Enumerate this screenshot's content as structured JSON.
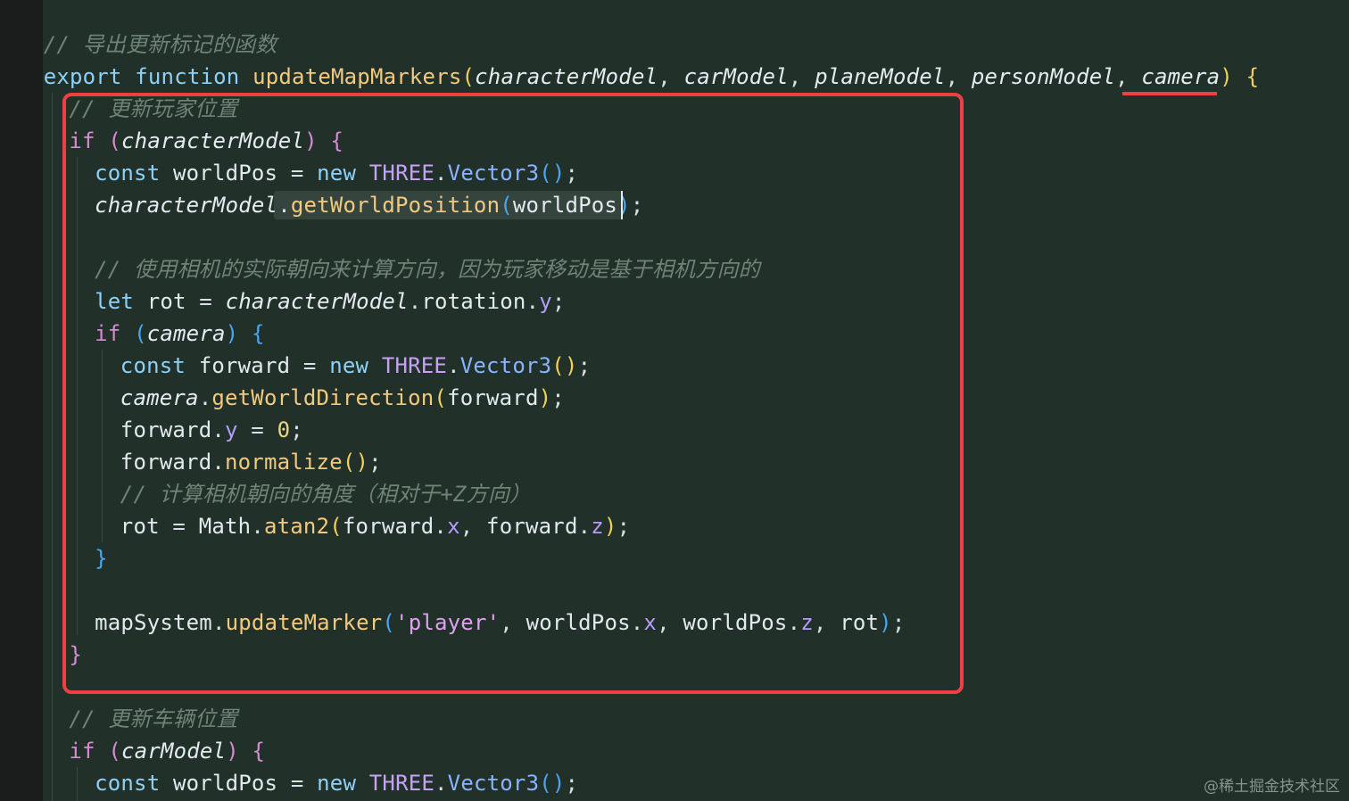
{
  "editor": {
    "lines": [
      {
        "name": "line-comment-export",
        "indent": 1,
        "tokens": [
          [
            "cmt",
            "// 导出更新标记的函数"
          ]
        ]
      },
      {
        "name": "line-export-function",
        "indent": 1,
        "tokens": [
          [
            "kw",
            "export"
          ],
          [
            "pun",
            " "
          ],
          [
            "kw",
            "function"
          ],
          [
            "pun",
            " "
          ],
          [
            "fn",
            "updateMapMarkers"
          ],
          [
            "b1",
            "("
          ],
          [
            "prm",
            "characterModel"
          ],
          [
            "pun",
            ", "
          ],
          [
            "prm",
            "carModel"
          ],
          [
            "pun",
            ", "
          ],
          [
            "prm",
            "planeModel"
          ],
          [
            "pun",
            ", "
          ],
          [
            "prm",
            "personModel"
          ],
          [
            "pun",
            ", "
          ],
          [
            "prm",
            "camera"
          ],
          [
            "b1",
            ")"
          ],
          [
            "pun",
            " "
          ],
          [
            "b1",
            "{"
          ]
        ]
      },
      {
        "name": "line-comment-player",
        "indent": 2,
        "tokens": [
          [
            "cmt",
            "// 更新玩家位置"
          ]
        ]
      },
      {
        "name": "line-if-character",
        "indent": 2,
        "tokens": [
          [
            "kwp",
            "if"
          ],
          [
            "pun",
            " "
          ],
          [
            "b2",
            "("
          ],
          [
            "prm",
            "characterModel"
          ],
          [
            "b2",
            ")"
          ],
          [
            "pun",
            " "
          ],
          [
            "b2",
            "{"
          ]
        ]
      },
      {
        "name": "line-const-worldpos",
        "indent": 3,
        "tokens": [
          [
            "kw",
            "const"
          ],
          [
            "pun",
            " "
          ],
          [
            "var",
            "worldPos"
          ],
          [
            "pun",
            " = "
          ],
          [
            "kw",
            "new"
          ],
          [
            "pun",
            " "
          ],
          [
            "cls",
            "THREE"
          ],
          [
            "pun",
            "."
          ],
          [
            "mth",
            "Vector3"
          ],
          [
            "b3",
            "()"
          ],
          [
            "pun",
            ";"
          ]
        ]
      },
      {
        "name": "line-get-world-position",
        "indent": 3,
        "tokens": [
          [
            "prm",
            "characterModel"
          ],
          [
            "pun",
            "."
          ],
          [
            "fn",
            "getWorldPosition"
          ],
          [
            "b3",
            "("
          ],
          [
            "var",
            "worldPos"
          ],
          [
            "b3",
            ")"
          ],
          [
            "pun",
            ";"
          ]
        ]
      },
      {
        "name": "line-blank-1",
        "indent": 0,
        "tokens": []
      },
      {
        "name": "line-comment-camera",
        "indent": 3,
        "tokens": [
          [
            "cmt",
            "// 使用相机的实际朝向来计算方向，因为玩家移动是基于相机方向的"
          ]
        ]
      },
      {
        "name": "line-let-rot",
        "indent": 3,
        "tokens": [
          [
            "kw",
            "let"
          ],
          [
            "pun",
            " "
          ],
          [
            "var",
            "rot"
          ],
          [
            "pun",
            " = "
          ],
          [
            "prm",
            "characterModel"
          ],
          [
            "pun",
            "."
          ],
          [
            "var",
            "rotation"
          ],
          [
            "pun",
            "."
          ],
          [
            "prp",
            "y"
          ],
          [
            "pun",
            ";"
          ]
        ]
      },
      {
        "name": "line-if-camera",
        "indent": 3,
        "tokens": [
          [
            "kwp",
            "if"
          ],
          [
            "pun",
            " "
          ],
          [
            "b3",
            "("
          ],
          [
            "prm",
            "camera"
          ],
          [
            "b3",
            ")"
          ],
          [
            "pun",
            " "
          ],
          [
            "b3",
            "{"
          ]
        ]
      },
      {
        "name": "line-const-forward",
        "indent": 4,
        "tokens": [
          [
            "kw",
            "const"
          ],
          [
            "pun",
            " "
          ],
          [
            "var",
            "forward"
          ],
          [
            "pun",
            " = "
          ],
          [
            "kw",
            "new"
          ],
          [
            "pun",
            " "
          ],
          [
            "cls",
            "THREE"
          ],
          [
            "pun",
            "."
          ],
          [
            "mth",
            "Vector3"
          ],
          [
            "b1",
            "()"
          ],
          [
            "pun",
            ";"
          ]
        ]
      },
      {
        "name": "line-get-world-direction",
        "indent": 4,
        "tokens": [
          [
            "prm",
            "camera"
          ],
          [
            "pun",
            "."
          ],
          [
            "fn",
            "getWorldDirection"
          ],
          [
            "b1",
            "("
          ],
          [
            "var",
            "forward"
          ],
          [
            "b1",
            ")"
          ],
          [
            "pun",
            ";"
          ]
        ]
      },
      {
        "name": "line-forward-y",
        "indent": 4,
        "tokens": [
          [
            "var",
            "forward"
          ],
          [
            "pun",
            "."
          ],
          [
            "prp",
            "y"
          ],
          [
            "pun",
            " = "
          ],
          [
            "num",
            "0"
          ],
          [
            "pun",
            ";"
          ]
        ]
      },
      {
        "name": "line-normalize",
        "indent": 4,
        "tokens": [
          [
            "var",
            "forward"
          ],
          [
            "pun",
            "."
          ],
          [
            "fn",
            "normalize"
          ],
          [
            "b1",
            "()"
          ],
          [
            "pun",
            ";"
          ]
        ]
      },
      {
        "name": "line-comment-angle",
        "indent": 4,
        "tokens": [
          [
            "cmt",
            "// 计算相机朝向的角度（相对于+Z方向）"
          ]
        ]
      },
      {
        "name": "line-rot-atan2",
        "indent": 4,
        "tokens": [
          [
            "var",
            "rot"
          ],
          [
            "pun",
            " = "
          ],
          [
            "var",
            "Math"
          ],
          [
            "pun",
            "."
          ],
          [
            "fn",
            "atan2"
          ],
          [
            "b1",
            "("
          ],
          [
            "var",
            "forward"
          ],
          [
            "pun",
            "."
          ],
          [
            "prp",
            "x"
          ],
          [
            "pun",
            ", "
          ],
          [
            "var",
            "forward"
          ],
          [
            "pun",
            "."
          ],
          [
            "prp",
            "z"
          ],
          [
            "b1",
            ")"
          ],
          [
            "pun",
            ";"
          ]
        ]
      },
      {
        "name": "line-close-if-camera",
        "indent": 3,
        "tokens": [
          [
            "b3",
            "}"
          ]
        ]
      },
      {
        "name": "line-blank-2",
        "indent": 0,
        "tokens": []
      },
      {
        "name": "line-update-marker",
        "indent": 3,
        "tokens": [
          [
            "var",
            "mapSystem"
          ],
          [
            "pun",
            "."
          ],
          [
            "fn",
            "updateMarker"
          ],
          [
            "b3",
            "("
          ],
          [
            "str",
            "'player'"
          ],
          [
            "pun",
            ", "
          ],
          [
            "var",
            "worldPos"
          ],
          [
            "pun",
            "."
          ],
          [
            "prp",
            "x"
          ],
          [
            "pun",
            ", "
          ],
          [
            "var",
            "worldPos"
          ],
          [
            "pun",
            "."
          ],
          [
            "prp",
            "z"
          ],
          [
            "pun",
            ", "
          ],
          [
            "var",
            "rot"
          ],
          [
            "b3",
            ")"
          ],
          [
            "pun",
            ";"
          ]
        ]
      },
      {
        "name": "line-close-if-character",
        "indent": 2,
        "tokens": [
          [
            "b2",
            "}"
          ]
        ]
      },
      {
        "name": "line-blank-3",
        "indent": 0,
        "tokens": []
      },
      {
        "name": "line-comment-vehicle",
        "indent": 2,
        "tokens": [
          [
            "cmt",
            "// 更新车辆位置"
          ]
        ]
      },
      {
        "name": "line-if-car",
        "indent": 2,
        "tokens": [
          [
            "kwp",
            "if"
          ],
          [
            "pun",
            " "
          ],
          [
            "b2",
            "("
          ],
          [
            "prm",
            "carModel"
          ],
          [
            "b2",
            ")"
          ],
          [
            "pun",
            " "
          ],
          [
            "b2",
            "{"
          ]
        ]
      },
      {
        "name": "line-const-worldpos-car",
        "indent": 3,
        "tokens": [
          [
            "kw",
            "const"
          ],
          [
            "pun",
            " "
          ],
          [
            "var",
            "worldPos"
          ],
          [
            "pun",
            " = "
          ],
          [
            "kw",
            "new"
          ],
          [
            "pun",
            " "
          ],
          [
            "cls",
            "THREE"
          ],
          [
            "pun",
            "."
          ],
          [
            "mth",
            "Vector3"
          ],
          [
            "b3",
            "()"
          ],
          [
            "pun",
            ";"
          ]
        ]
      }
    ]
  },
  "watermark": {
    "text": "@稀土掘金技术社区"
  },
  "colors": {
    "highlight_box": "#ee3f43",
    "editor_bg": "#213028"
  }
}
